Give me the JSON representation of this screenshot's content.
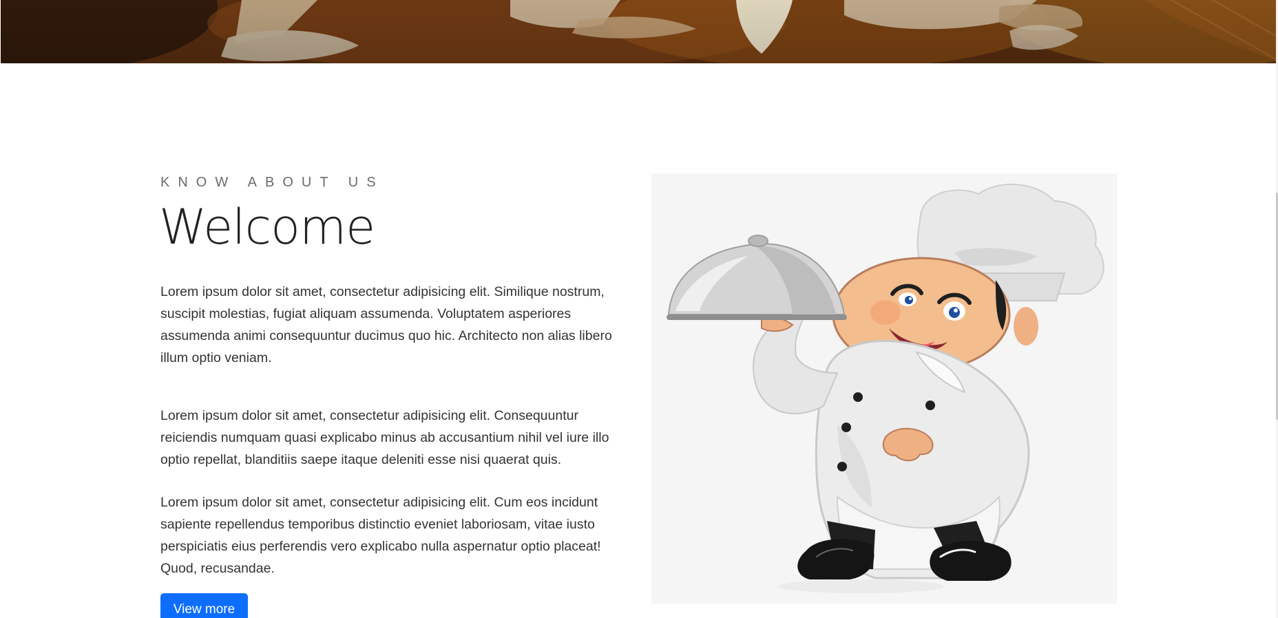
{
  "about": {
    "eyebrow": "KNOW ABOUT US",
    "title": "Welcome",
    "paragraphs": [
      "Lorem ipsum dolor sit amet, consectetur adipisicing elit. Similique nostrum, suscipit molestias, fugiat aliquam assumenda. Voluptatem asperiores assumenda animi consequuntur ducimus quo hic. Architecto non alias libero illum optio veniam.",
      "Lorem ipsum dolor sit amet, consectetur adipisicing elit. Consequuntur reiciendis numquam quasi explicabo minus ab accusantium nihil vel iure illo optio repellat, blanditiis saepe itaque deleniti esse nisi quaerat quis.",
      "Lorem ipsum dolor sit amet, consectetur adipisicing elit. Cum eos incidunt sapiente repellendus temporibus distinctio eveniet laboriosam, vitae iusto perspiciatis eius perferendis vero explicabo nulla aspernatur optio placeat! Quod, recusandae."
    ],
    "button_label": "View more"
  },
  "colors": {
    "accent": "#0d6efd",
    "text": "#333333",
    "heading": "#222222",
    "image_panel_bg": "#f5f5f5"
  },
  "icons": {
    "hero": "restaurant-banner-image",
    "chef": "chef-illustration"
  }
}
